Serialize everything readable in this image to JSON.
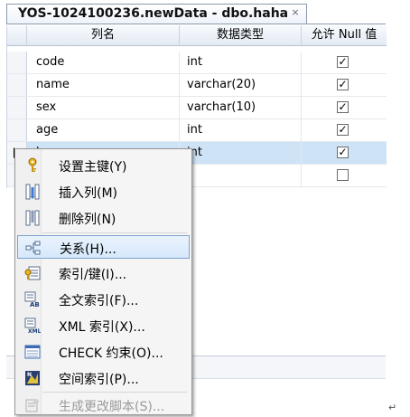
{
  "tab": {
    "title": "YOS-1024100236.newData - dbo.haha",
    "close": "×"
  },
  "grid": {
    "headers": {
      "column_name": "列名",
      "data_type": "数据类型",
      "allow_null": "允许 Null 值"
    },
    "rows": [
      {
        "name": "code",
        "type": "int",
        "allow_null": true
      },
      {
        "name": "name",
        "type": "varchar(20)",
        "allow_null": true
      },
      {
        "name": "sex",
        "type": "varchar(10)",
        "allow_null": true
      },
      {
        "name": "age",
        "type": "int",
        "allow_null": true
      },
      {
        "name": "human",
        "type": "int",
        "allow_null": true,
        "selected": true
      },
      {
        "name": "",
        "type": "",
        "allow_null": false
      }
    ]
  },
  "context_menu": {
    "items": [
      {
        "label": "设置主键(Y)",
        "icon": "primary-key-icon"
      },
      {
        "label": "插入列(M)",
        "icon": "insert-column-icon"
      },
      {
        "label": "删除列(N)",
        "icon": "delete-column-icon"
      },
      {
        "label": "关系(H)...",
        "icon": "relationship-icon",
        "highlighted": true
      },
      {
        "label": "索引/键(I)...",
        "icon": "index-key-icon"
      },
      {
        "label": "全文索引(F)...",
        "icon": "fulltext-index-icon"
      },
      {
        "label": "XML 索引(X)...",
        "icon": "xml-index-icon"
      },
      {
        "label": "CHECK 约束(O)...",
        "icon": "check-constraint-icon"
      },
      {
        "label": "空间索引(P)...",
        "icon": "spatial-index-icon"
      },
      {
        "label": "生成更改脚本(S)...",
        "icon": "generate-script-icon",
        "disabled": true
      }
    ]
  },
  "page": {
    "paragraph_mark": "↵"
  }
}
